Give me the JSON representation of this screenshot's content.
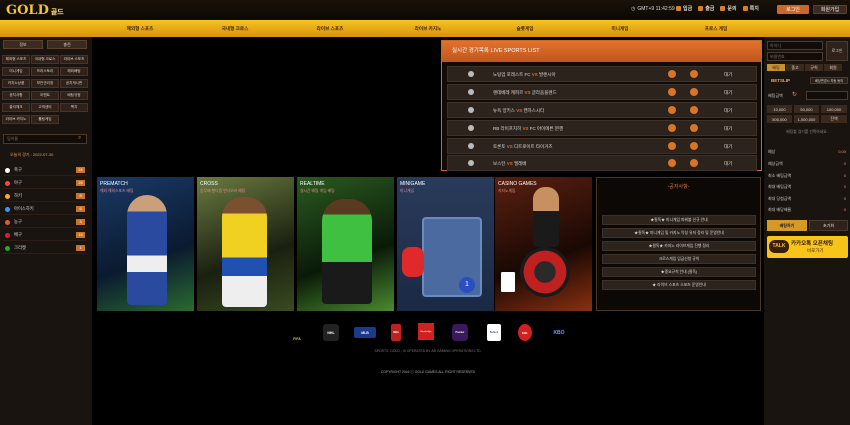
{
  "header": {
    "logo": "GOLD",
    "logo_sub": "골드",
    "clock": "GMT+9 11:42:59",
    "links": [
      "입금",
      "출금",
      "문의",
      "쪽지"
    ],
    "login": "로그인",
    "join": "회원가입"
  },
  "nav": [
    "해외형 스포츠",
    "국내형 크로스",
    "라이브 스포츠",
    "라이브 카지노",
    "슬롯게임",
    "미니게임",
    "프로스 게임"
  ],
  "left": {
    "tabs": [
      "정보",
      "충전"
    ],
    "links": [
      "해외형 스포츠",
      "국내형 크로스",
      "라이브 스포츠",
      "미니게임",
      "프리스토리",
      "해외배팅",
      "카지노상품",
      "보안관리장",
      "공지게시판",
      "공지사항",
      "이벤트",
      "배팅규정",
      "출석체크",
      "고객센터",
      "쪽지",
      "라이브 카지노",
      "롤링게임"
    ],
    "search_placeholder": "팀이름",
    "date": "오늘의 경기 : 2022-07-30",
    "sports": [
      {
        "name": "축구",
        "count": "24",
        "color": "#ffffff"
      },
      {
        "name": "야구",
        "count": "26",
        "color": "#ff4444"
      },
      {
        "name": "하키",
        "count": "8",
        "color": "#ffaa22"
      },
      {
        "name": "아이스하키",
        "count": "6",
        "color": "#3399ff"
      },
      {
        "name": "농구",
        "count": "3",
        "color": "#e06020"
      },
      {
        "name": "배구",
        "count": "16",
        "color": "#e02020"
      },
      {
        "name": "크리켓",
        "count": "1",
        "color": "#22aa33"
      }
    ]
  },
  "live": {
    "title": "실시간 경기목록",
    "title_en": "LIVE SPORTS LIST",
    "matches": [
      {
        "home": "노팅엄 포레스트 FC",
        "away": "발렌시아",
        "status": "대기"
      },
      {
        "home": "랜데베레 캐피르",
        "away": "글라움블렌드",
        "status": "대기"
      },
      {
        "home": "뉴욕 양키스",
        "away": "캔자스시티",
        "status": "대기"
      },
      {
        "home": "RB 라이프치히",
        "away": "FC 아이에른 뮌헨",
        "status": "대기"
      },
      {
        "home": "토론토",
        "away": "디트로이트 타이거즈",
        "status": "대기"
      },
      {
        "home": "보스턴",
        "away": "엘레베",
        "status": "대기"
      }
    ],
    "vs": "VS"
  },
  "cards": [
    {
      "title": "PREMATCH",
      "sub": "해외 해외스포츠 배팅",
      "color": "#1a3a66"
    },
    {
      "title": "CROSS",
      "sub": "승무패 핸디캡 언더오버 배팅",
      "color": "#b8a030"
    },
    {
      "title": "REALTIME",
      "sub": "실시간 배팅 게임 배팅",
      "color": "#2a5a20"
    },
    {
      "title": "MINIGAME",
      "sub": "미니게임",
      "color": "#3a4a66"
    },
    {
      "title": "CASINO GAMES",
      "sub": "카지노게임",
      "color": "#5a2010"
    }
  ],
  "notice": {
    "title": "공지사항",
    "items": [
      "★필독★ 미니게임 파워볼 신규 안내",
      "★필독★ 미니게임 및 카지노 악성 유저 정리 및 운영안내",
      "★필독★ 카지노 라이브게임 진행 정리",
      "크로스게임 입금신청 규칙",
      "★중요규칙 안내 (필독)",
      "★ 라이브 스포츠 스포츠 운영안내"
    ]
  },
  "logos": [
    "FIFA",
    "NHL",
    "MLB",
    "NBA",
    "Bundesliga",
    "Premier",
    "Serie A",
    "KBL",
    "KBO"
  ],
  "footer": {
    "line1": "SPORTS ,GOLD , IS OPERATED BY AB GAMING OPERATIONS LTD.",
    "line2": "COPYRIGHT 2016 ⓒ GOLD GAMES ALL RIGHT RESERVED"
  },
  "right": {
    "login_label": "로그인",
    "id_placeholder": "아이디",
    "pw_placeholder": "비밀번호",
    "small_tabs": [
      "배팅",
      "중고",
      "규칙",
      "회원"
    ],
    "betslip": "BETSLIP",
    "auto_label": "배당변경시 자동 동의",
    "bet_amount": "배팅금액",
    "quick": [
      "10,000",
      "50,000",
      "100,000",
      "500,000",
      "1,000,000",
      "잔액"
    ],
    "empty": "배팅할 경기를 선택하세요.",
    "fields": [
      {
        "label": "예상",
        "value": "0.00"
      },
      {
        "label": "예상금액",
        "value": "0"
      },
      {
        "label": "최소 배팅금액",
        "value": "0"
      },
      {
        "label": "최대 배팅금액",
        "value": "0"
      },
      {
        "label": "최대 당첨금액",
        "value": "0"
      },
      {
        "label": "최대 배당배율",
        "value": "0"
      }
    ],
    "bet_btn": "배팅하기",
    "reset_btn": "초기화",
    "kakao": "카카오톡 오픈채팅",
    "kakao_sub": "바로가기"
  }
}
